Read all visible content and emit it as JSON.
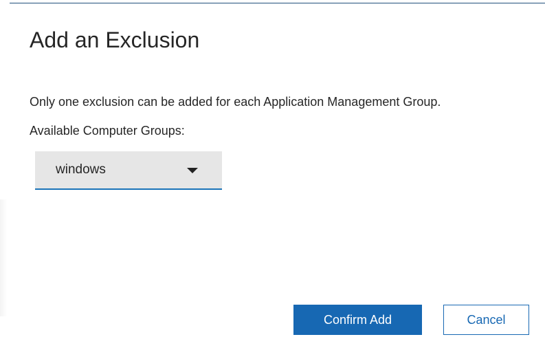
{
  "dialog": {
    "title": "Add an Exclusion",
    "info_text": "Only one exclusion can be added for each Application Management Group.",
    "groups_label": "Available Computer Groups:",
    "computer_group_select": {
      "selected_value": "windows",
      "icon": "caret-down-icon"
    },
    "buttons": {
      "confirm_label": "Confirm Add",
      "cancel_label": "Cancel"
    }
  },
  "colors": {
    "accent": "#1768b3",
    "select_background": "#e6e6e6",
    "text": "#262626",
    "top_border": "#1f4f7a"
  }
}
